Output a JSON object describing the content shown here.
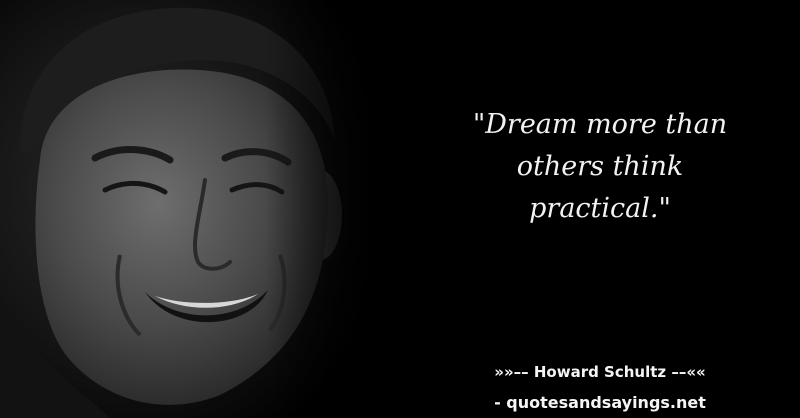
{
  "quote": {
    "lines": [
      "\"Dream more than",
      "others think",
      "practical.\""
    ]
  },
  "author": {
    "label": "»»–– Howard Schultz ––««"
  },
  "source": {
    "label": "- quotesandsayings.net"
  },
  "colors": {
    "background": "#000000",
    "text": "#f2f2f2"
  }
}
